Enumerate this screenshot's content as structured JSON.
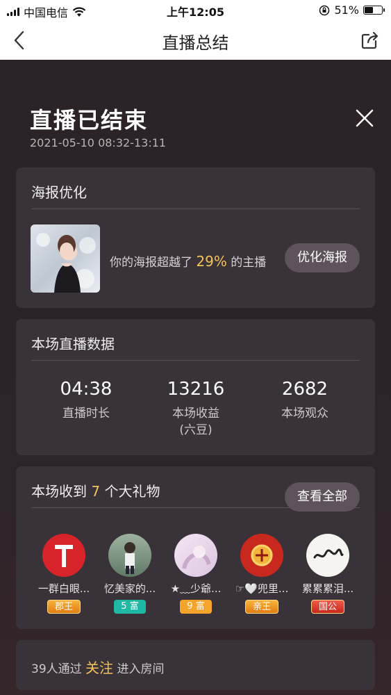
{
  "status_bar": {
    "carrier": "中国电信",
    "time": "上午12:05",
    "battery_percent": "51%",
    "battery_level": 0.51
  },
  "nav": {
    "title": "直播总结",
    "back_icon": "chevron-left-icon",
    "share_icon": "share-icon"
  },
  "summary": {
    "title": "直播已结束",
    "time_range": "2021-05-10 08:32-13:11",
    "close_icon": "close-icon"
  },
  "poster": {
    "heading": "海报优化",
    "text_before": "你的海报超越了",
    "percent": "29%",
    "text_after": "的主播",
    "button": "优化海报"
  },
  "stats": {
    "heading": "本场直播数据",
    "items": [
      {
        "value": "04:38",
        "label": "直播时长",
        "sub": ""
      },
      {
        "value": "13216",
        "label": "本场收益",
        "sub": "(六豆)"
      },
      {
        "value": "2682",
        "label": "本场观众",
        "sub": ""
      }
    ]
  },
  "gifts": {
    "heading_before": "本场收到",
    "count": "7",
    "heading_after": "个大礼物",
    "button": "查看全部",
    "users": [
      {
        "name": "一群白眼...",
        "badge": "郡王",
        "badge_color": "#e27c12"
      },
      {
        "name": "忆美家的...",
        "badge": "5 富",
        "badge_color": "#1eb8a5"
      },
      {
        "name": "★﹏少爺...",
        "badge": "9 富",
        "badge_color": "#f4a42b"
      },
      {
        "name": "☞🤍兜里...",
        "badge": "亲王",
        "badge_color": "#e27c12"
      },
      {
        "name": "累累累泪...",
        "badge": "国公",
        "badge_color": "#c8281d"
      }
    ]
  },
  "follow": {
    "text_before": "39人通过",
    "highlight": "关注",
    "text_after": "进入房间"
  },
  "colors": {
    "accent": "#f5c35a",
    "card_bg": "#3a3239",
    "button_bg": "#5e535c"
  }
}
